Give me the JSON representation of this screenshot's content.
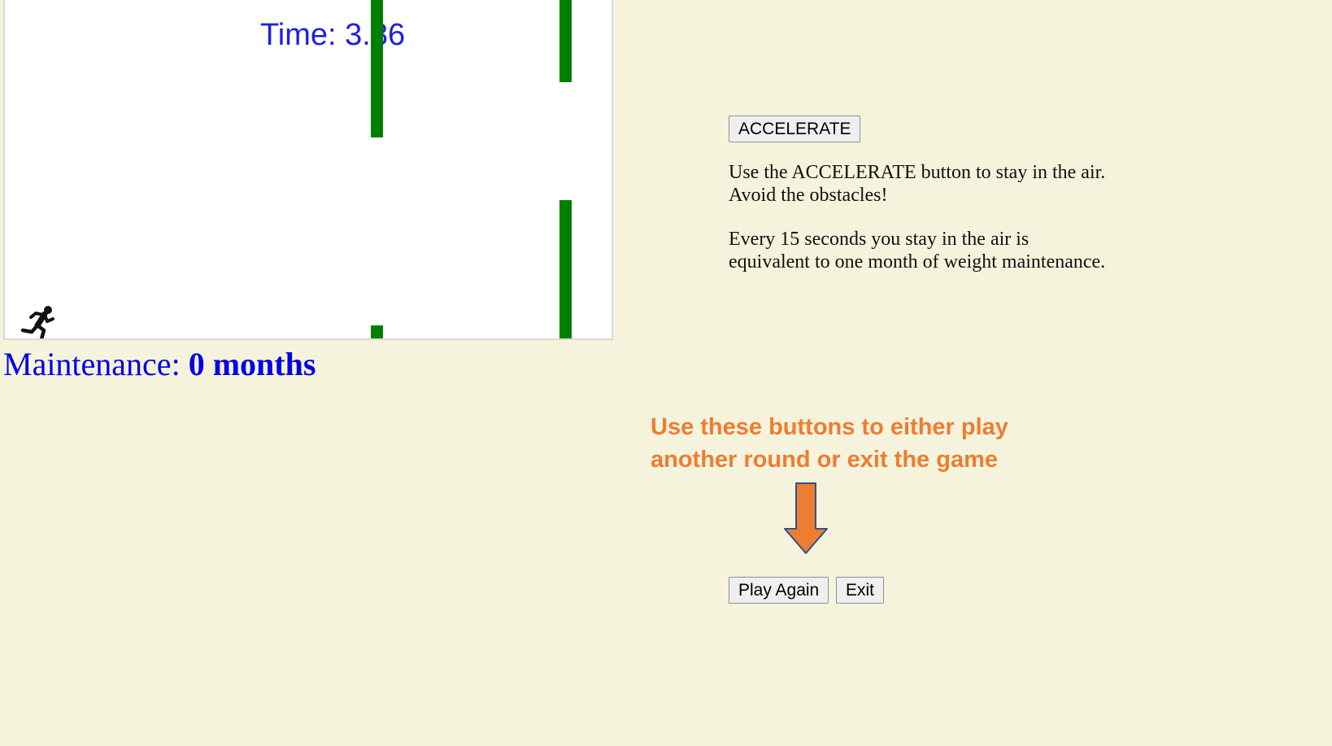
{
  "game": {
    "timer_label": "Time: 3.86",
    "player_icon": "running-person-icon",
    "obstacle_color": "#008000"
  },
  "status": {
    "maintenance_label": "Maintenance:",
    "maintenance_value": "0 months"
  },
  "controls": {
    "accelerate_label": "ACCELERATE",
    "play_again_label": "Play Again",
    "exit_label": "Exit"
  },
  "instructions": {
    "line1": "Use the ACCELERATE button to stay in the air. Avoid the obstacles!",
    "line2": "Every 15 seconds you stay in the air is equivalent to one month of weight maintenance."
  },
  "callout": {
    "text": "Use these buttons to either play another round or exit the game",
    "arrow_icon": "down-arrow-icon",
    "color": "#ed7d31"
  },
  "colors": {
    "background": "#f5f3dc",
    "text_blue": "#0000e6",
    "timer_blue": "#2020e0"
  }
}
